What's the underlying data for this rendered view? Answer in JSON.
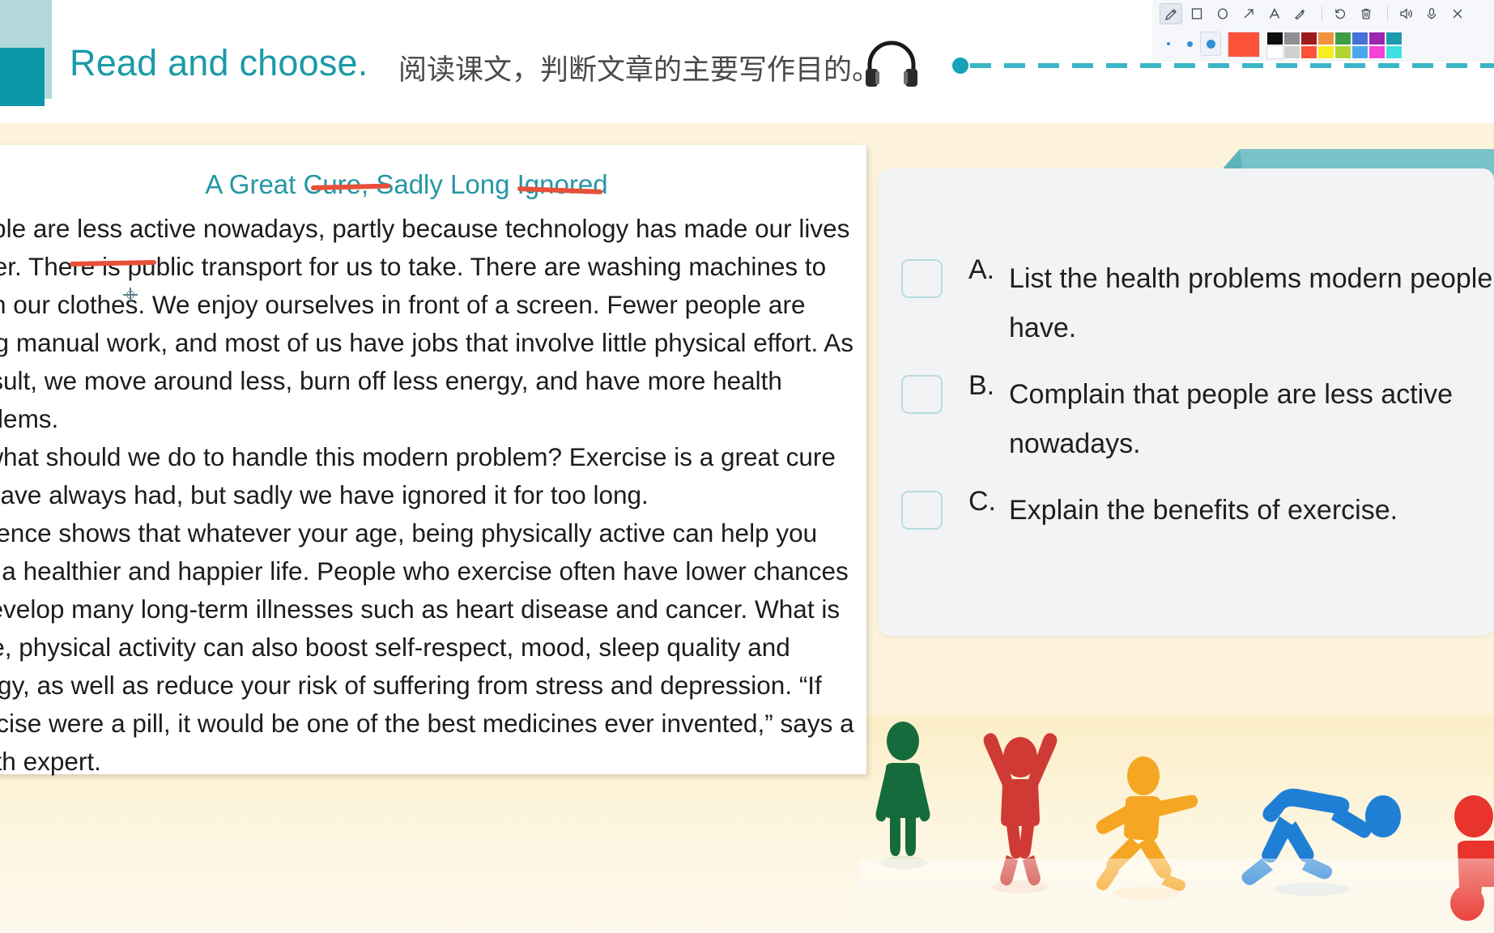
{
  "header": {
    "title": "Read and choose.",
    "subtitle": "阅读课文，判断文章的主要写作目的。",
    "audio_icon": "headphone-icon"
  },
  "toolbar": {
    "tools": [
      {
        "name": "pen-tool",
        "icon": "pencil-icon",
        "active": true
      },
      {
        "name": "rectangle-tool",
        "icon": "square-icon",
        "active": false
      },
      {
        "name": "ellipse-tool",
        "icon": "circle-icon",
        "active": false
      },
      {
        "name": "arrow-tool",
        "icon": "arrow-icon",
        "active": false
      },
      {
        "name": "text-tool",
        "icon": "letter-a-icon",
        "active": false
      },
      {
        "name": "magic-eraser-tool",
        "icon": "magic-wand-icon",
        "active": false
      },
      {
        "name": "undo-button",
        "icon": "undo-icon",
        "active": false
      },
      {
        "name": "delete-button",
        "icon": "trash-icon",
        "active": false
      },
      {
        "name": "volume-button",
        "icon": "speaker-icon",
        "active": false
      },
      {
        "name": "microphone-button",
        "icon": "microphone-icon",
        "active": false
      },
      {
        "name": "close-button",
        "icon": "close-icon",
        "active": false
      }
    ],
    "stroke_sizes": [
      2,
      5,
      9
    ],
    "stroke_size_selected_index": 2,
    "current_color": "#fb5239",
    "palette_row1": [
      "#0d0d0d",
      "#8e8e93",
      "#9e1b1b",
      "#f0933e",
      "#3d9e4a",
      "#4472d8",
      "#9b27b0",
      "#1e9aad"
    ],
    "palette_row2": [
      "#ffffff",
      "#d0d0d0",
      "#fb5239",
      "#f7ee1e",
      "#b3d531",
      "#4ba8ef",
      "#f541d8",
      "#3fe0e0"
    ]
  },
  "article": {
    "title": "A Great Cure, Sadly Long Ignored",
    "paragraphs": [
      "People are less active nowadays, partly because technology has made our lives easier. There is public transport for us to take. There are washing machines to wash our clothes. We enjoy ourselves in front of a screen. Fewer people are doing manual work, and most of us have jobs that involve little physical effort. As a result, we move around less, burn off less energy, and have more health problems.",
      "So what should we do to handle this modern problem? Exercise is a great cure we have always had, but sadly we have ignored it for too long.",
      "Evidence shows that whatever your age, being physically active can help you lead a healthier and happier life. People who exercise often have lower chances to develop many long-term illnesses such as heart disease and cancer. What is more, physical activity can also boost self-respect, mood, sleep quality and energy, as well as reduce your risk of suffering from stress and depression. “If exercise were a pill, it would be one of the best medicines ever invented,” says a health expert."
    ],
    "annotation_color": "#e8503a",
    "annotated_words": [
      "Great",
      "Ignored",
      "easier"
    ]
  },
  "question": {
    "options": [
      {
        "letter": "A.",
        "text": "List the health problems modern people have.",
        "checked": false
      },
      {
        "letter": "B.",
        "text": "Complain that people are less active nowadays.",
        "checked": false
      },
      {
        "letter": "C.",
        "text": "Explain the benefits of exercise.",
        "checked": false
      }
    ]
  },
  "decor": {
    "figures": [
      {
        "name": "standing-figure",
        "color": "#166b3c"
      },
      {
        "name": "arms-up-figure",
        "color": "#cf3a35"
      },
      {
        "name": "running-figure",
        "color": "#f5a623"
      },
      {
        "name": "bending-figure",
        "color": "#1f7fd4"
      },
      {
        "name": "partial-figure",
        "color": "#e8342c"
      }
    ],
    "ribbon_color": "#78c3c9",
    "accent_color": "#0b97a8",
    "slide_background": "#fdf3dc"
  }
}
